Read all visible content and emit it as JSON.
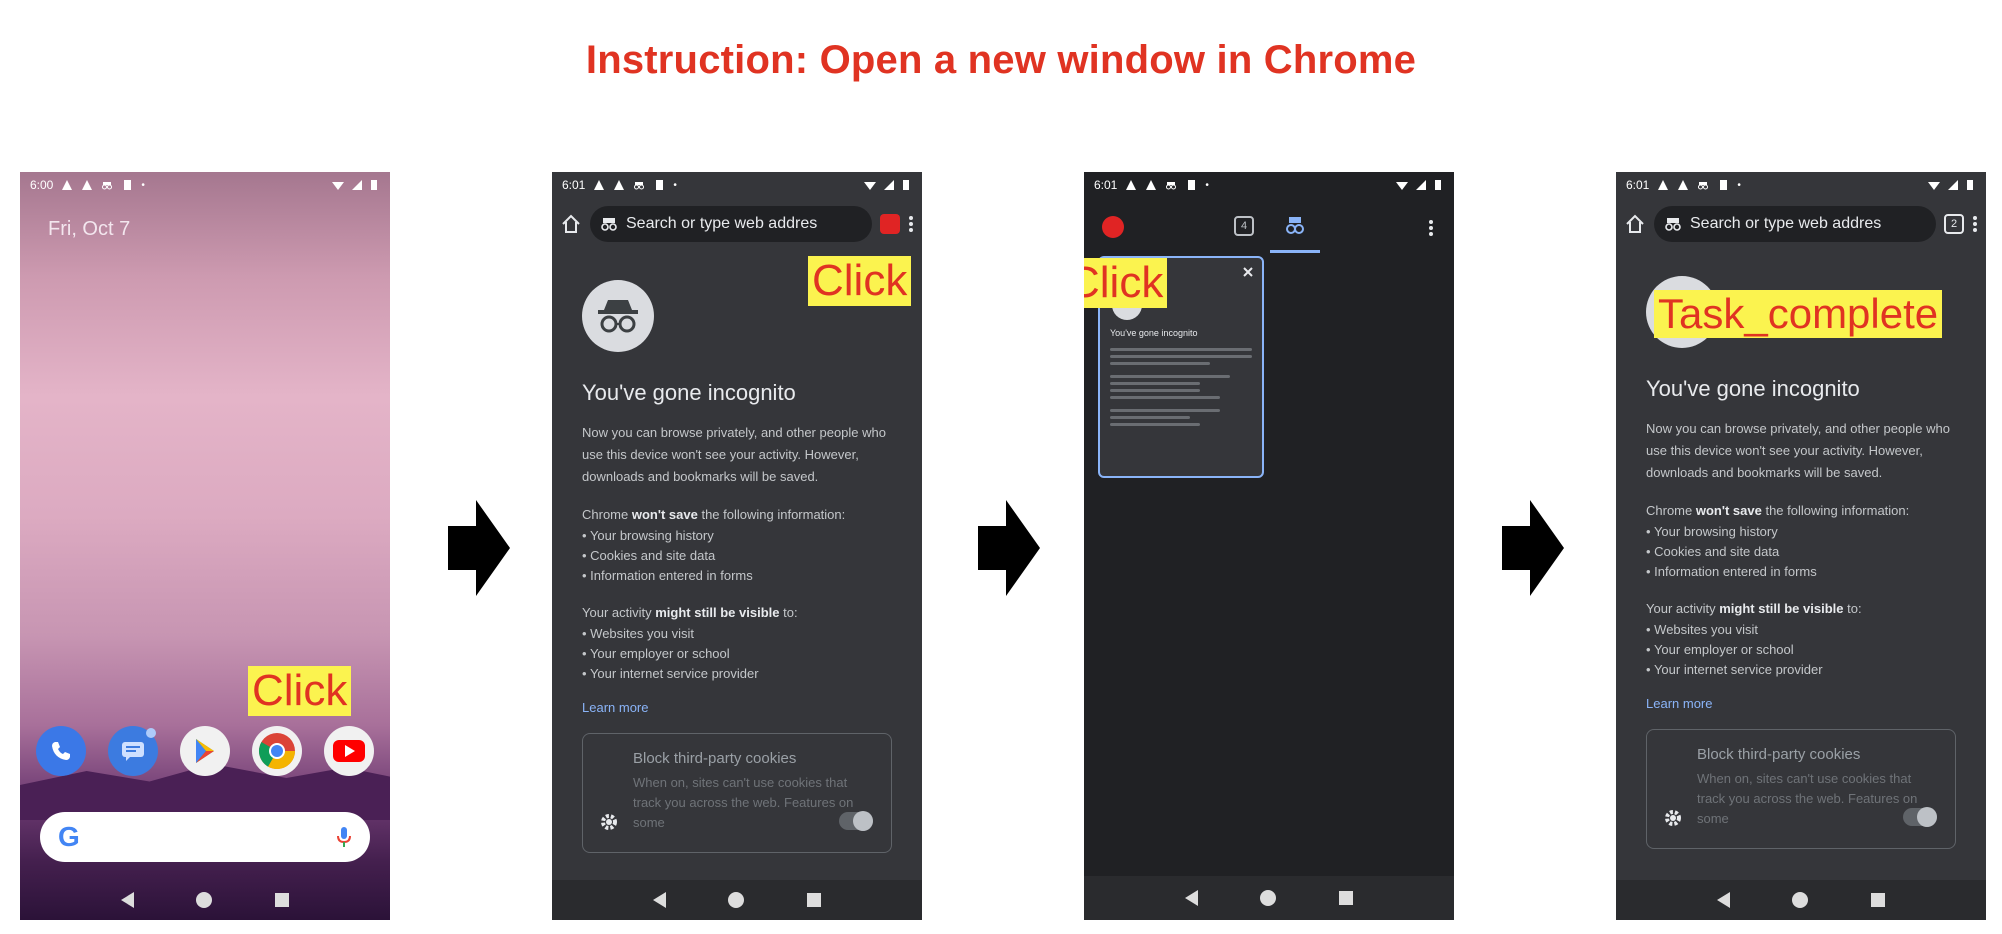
{
  "instruction": "Instruction: Open a new window in Chrome",
  "annotations": {
    "click": "Click",
    "task_complete": "Task_complete"
  },
  "home_screen": {
    "status_time": "6:00",
    "date": "Fri, Oct 7",
    "dock_apps": [
      "phone-icon",
      "messages-icon",
      "play-store-icon",
      "chrome-icon",
      "youtube-icon"
    ],
    "search_logo": "G"
  },
  "incognito_screen": {
    "status_time": "6:01",
    "omnibox_placeholder": "Search or type web addres",
    "tab_count": "2",
    "heading": "You've gone incognito",
    "intro": "Now you can browse privately, and other people who use this device won't see your activity. However, downloads and bookmarks will be saved.",
    "wont_save_prefix": "Chrome",
    "wont_save_bold": "won't save",
    "wont_save_suffix": "the following information:",
    "wont_save_items": [
      "Your browsing history",
      "Cookies and site data",
      "Information entered in forms"
    ],
    "visible_prefix": "Your activity",
    "visible_bold": "might still be visible",
    "visible_suffix": "to:",
    "visible_items": [
      "Websites you visit",
      "Your employer or school",
      "Your internet service provider"
    ],
    "learn_more": "Learn more",
    "cookie_title": "Block third-party cookies",
    "cookie_desc": "When on, sites can't use cookies that track you across the web. Features on some"
  },
  "tab_switcher": {
    "status_time": "6:01",
    "tab_count": "4",
    "card_title": "ab",
    "card_heading": "You've gone incognito"
  },
  "colors": {
    "title_red": "#e03322",
    "highlight_yellow": "#fbf34f",
    "incognito_bg": "#35363a"
  }
}
